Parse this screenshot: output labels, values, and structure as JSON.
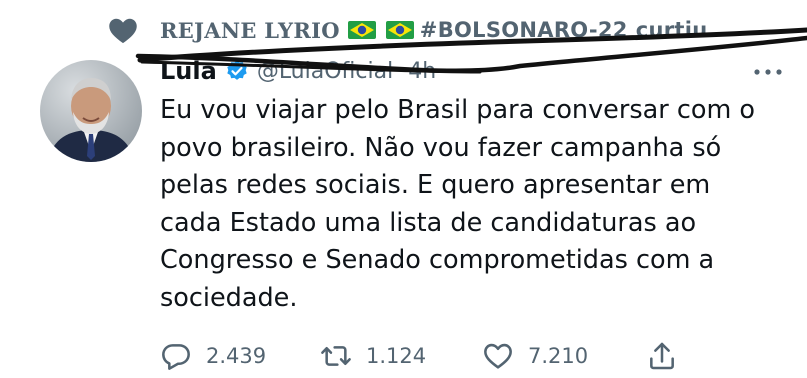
{
  "social_context": {
    "liker_name": "REJANE LYRIO",
    "liker_tag": "#BOLSONARO-22",
    "verb": "curtiu",
    "icon": "heart-icon"
  },
  "tweet": {
    "author_name": "Lula",
    "verified": true,
    "handle": "@LulaOficial",
    "time": "4h",
    "text_lines": [
      "Eu vou viajar pelo Brasil para conversar com o",
      "povo brasileiro. Não vou fazer campanha só",
      "pelas redes sociais. E quero apresentar em",
      "cada Estado uma lista de candidaturas ao",
      "Congresso e Senado comprometidas com a",
      "sociedade."
    ]
  },
  "actions": {
    "reply_count": "2.439",
    "retweet_count": "1.124",
    "like_count": "7.210"
  },
  "colors": {
    "text": "#0f1419",
    "secondary": "#536471",
    "verified": "#1d9bf0",
    "scribble": "#111111"
  }
}
